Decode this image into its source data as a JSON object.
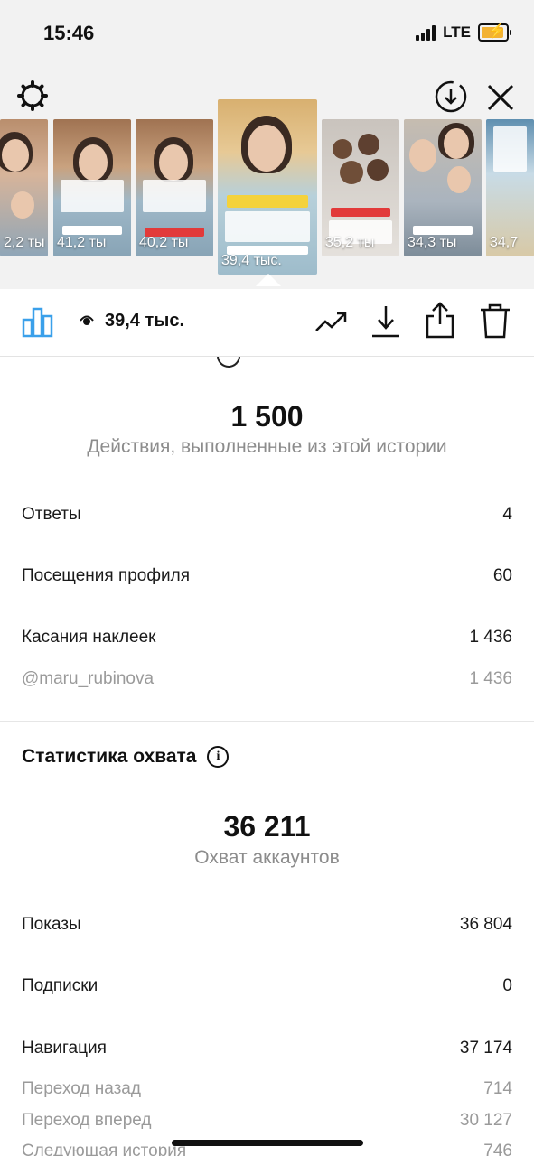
{
  "status_bar": {
    "time": "15:46",
    "network": "LTE"
  },
  "toolbar": {
    "settings_icon": "gear-icon",
    "download_icon": "download-circle-icon",
    "close_icon": "close-icon"
  },
  "thumbnails": [
    {
      "views": "2,2 ты"
    },
    {
      "views": "41,2 ты"
    },
    {
      "views": "40,2 ты"
    },
    {
      "views": "39,4 тыс.",
      "active": true
    },
    {
      "views": "35,2 ты"
    },
    {
      "views": "34,3 ты"
    },
    {
      "views": "34,7"
    }
  ],
  "action_bar": {
    "views": "39,4 тыс.",
    "icons": [
      "bar-chart-icon",
      "eye-icon",
      "trending-icon",
      "download-icon",
      "share-icon",
      "trash-icon"
    ]
  },
  "interactions": {
    "total": "1 500",
    "subtitle": "Действия, выполненные из этой истории",
    "rows": [
      {
        "label": "Ответы",
        "value": "4"
      },
      {
        "label": "Посещения профиля",
        "value": "60"
      },
      {
        "label": "Касания наклеек",
        "value": "1 436"
      }
    ],
    "sub_rows": [
      {
        "label": "@maru_rubinova",
        "value": "1 436"
      }
    ]
  },
  "reach": {
    "title": "Статистика охвата",
    "total": "36 211",
    "subtitle": "Охват аккаунтов",
    "rows": [
      {
        "label": "Показы",
        "value": "36 804"
      },
      {
        "label": "Подписки",
        "value": "0"
      },
      {
        "label": "Навигация",
        "value": "37 174"
      }
    ],
    "sub_rows": [
      {
        "label": "Переход назад",
        "value": "714"
      },
      {
        "label": "Переход вперед",
        "value": "30 127"
      },
      {
        "label": "Следующая история",
        "value": "746"
      }
    ]
  },
  "colors": {
    "accent": "#3aa0ea",
    "muted": "#8c8c8c",
    "background_top": "#f2f2f2"
  }
}
